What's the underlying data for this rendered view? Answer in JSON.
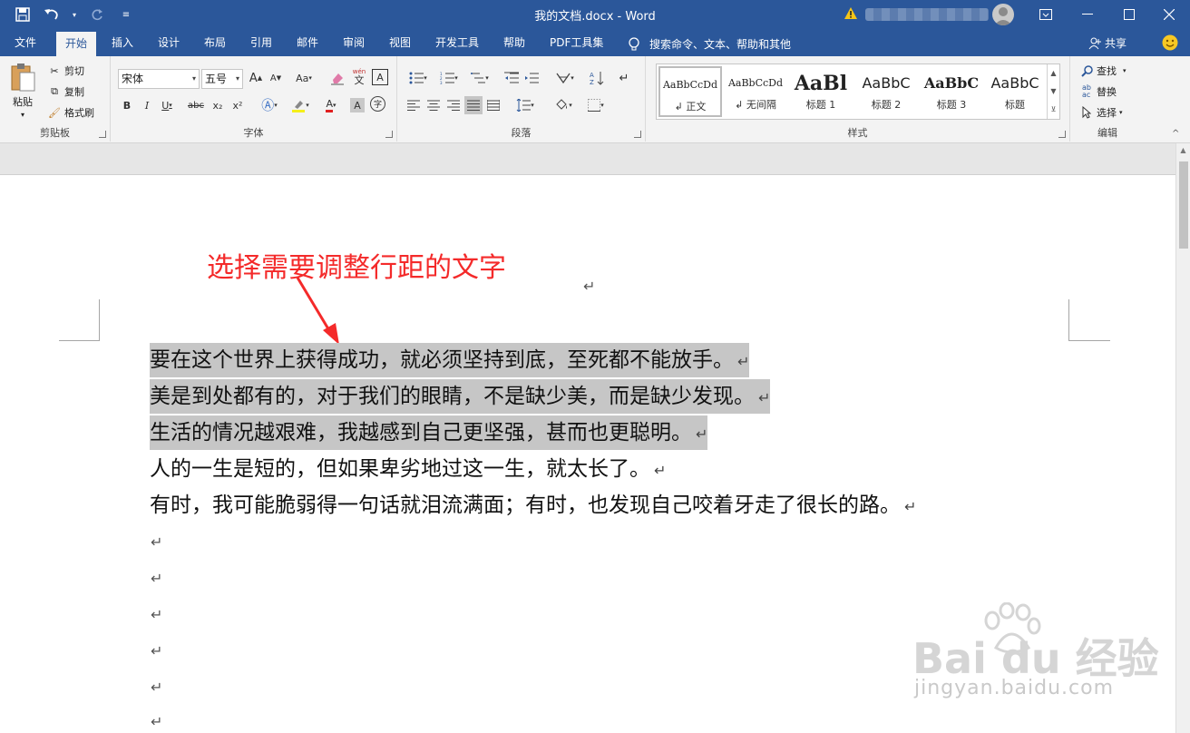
{
  "titlebar": {
    "title": "我的文档.docx  -  Word"
  },
  "menu": {
    "tabs": [
      "文件",
      "开始",
      "插入",
      "设计",
      "布局",
      "引用",
      "邮件",
      "审阅",
      "视图",
      "开发工具",
      "帮助",
      "PDF工具集"
    ],
    "active_tab": "开始",
    "tell_me": "搜索命令、文本、帮助和其他",
    "share": "共享"
  },
  "clipboard": {
    "paste": "粘贴",
    "cut": "剪切",
    "copy": "复制",
    "format_painter": "格式刷",
    "label": "剪贴板"
  },
  "font": {
    "name": "宋体",
    "size": "五号",
    "label": "字体",
    "bold": "B",
    "italic": "I",
    "underline": "U",
    "strikethrough": "abc",
    "subscript": "x₂",
    "superscript": "x²",
    "grow": "A",
    "shrink": "A",
    "change_case": "Aa",
    "phonetic": "wén",
    "font_color": "A",
    "char_shading": "A",
    "enclose": "字"
  },
  "paragraph": {
    "label": "段落"
  },
  "styles": {
    "label": "样式",
    "items": [
      {
        "preview": "AaBbCcDd",
        "name": "正文"
      },
      {
        "preview": "AaBbCcDd",
        "name": "无间隔"
      },
      {
        "preview": "AaBl",
        "name": "标题 1"
      },
      {
        "preview": "AaBbC",
        "name": "标题 2"
      },
      {
        "preview": "AaBbC",
        "name": "标题 3"
      },
      {
        "preview": "AaBbC",
        "name": "标题"
      }
    ]
  },
  "editing": {
    "find": "查找",
    "replace": "替换",
    "select": "选择",
    "label": "编辑"
  },
  "document": {
    "annotation": "选择需要调整行距的文字",
    "lines": [
      {
        "text": "要在这个世界上获得成功，就必须坚持到底，至死都不能放手。",
        "selected": true
      },
      {
        "text": "美是到处都有的，对于我们的眼睛，不是缺少美，而是缺少发现。",
        "selected": true
      },
      {
        "text": "生活的情况越艰难，我越感到自己更坚强，甚而也更聪明。",
        "selected": true
      },
      {
        "text": "人的一生是短的，但如果卑劣地过这一生，就太长了。",
        "selected": false
      },
      {
        "text": "有时，我可能脆弱得一句话就泪流满面；有时，也发现自己咬着牙走了很长的路。",
        "selected": false
      }
    ],
    "paragraph_mark": "↵"
  },
  "watermark": {
    "brand": "Bai du 经验",
    "url": "jingyan.baidu.com"
  },
  "colors": {
    "brand": "#2b579a",
    "annotation": "#f42a2a",
    "selection": "#c6c6c6"
  }
}
